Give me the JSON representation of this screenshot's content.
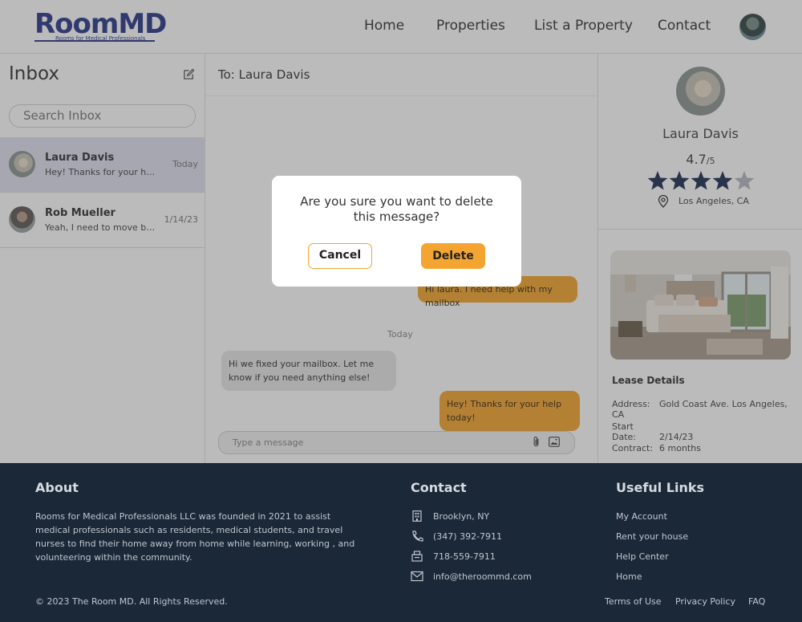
{
  "brand": {
    "logo_text": "RoomMD",
    "tagline": "Rooms for Medical Professionals",
    "accent_color": "#f4a531",
    "brand_color": "#2c3a8a"
  },
  "nav": {
    "home": "Home",
    "properties": "Properties",
    "list_property": "List a Property",
    "contact": "Contact"
  },
  "inbox": {
    "title": "Inbox",
    "search_placeholder": "Search Inbox",
    "conversations": [
      {
        "name": "Laura Davis",
        "preview": "Hey! Thanks for your help tod...",
        "date": "Today",
        "active": true
      },
      {
        "name": "Rob Mueller",
        "preview": "Yeah, I need to move by Fe...",
        "date": "1/14/23",
        "active": false
      }
    ]
  },
  "chat": {
    "to": "To: Laura Davis",
    "messages": [
      {
        "direction": "out",
        "text": "Hi laura. I need help with my mailbox"
      },
      {
        "direction": "in",
        "text": "Hi we fixed your mailbox. Let me know if you need anything else!"
      },
      {
        "direction": "out",
        "text": "Hey! Thanks for your help today!"
      }
    ],
    "day_separator": "Today",
    "input_placeholder": "Type a message"
  },
  "profile": {
    "name": "Laura Davis",
    "rating": "4.7",
    "rating_max": "/5",
    "stars_filled": 4,
    "stars_total": 5,
    "location": "Los Angeles, CA",
    "lease_title": "Lease Details",
    "lease": [
      {
        "label": "Address:",
        "value": "Gold Coast Ave. Los Angeles, CA"
      },
      {
        "label": "Start Date:",
        "value": "2/14/23"
      },
      {
        "label": "Contract:",
        "value": "6 months"
      }
    ]
  },
  "modal": {
    "message": "Are you sure you want to delete this message?",
    "cancel_label": "Cancel",
    "delete_label": "Delete"
  },
  "footer": {
    "about_title": "About",
    "about_text": "Rooms for Medical Professionals LLC was founded in 2021 to assist medical professionals such as residents, medical students, and travel nurses to find their home away from home while learning, working , and volunteering within the community.",
    "contact_title": "Contact",
    "contact_items": [
      {
        "icon": "building-icon",
        "text": "Brooklyn, NY"
      },
      {
        "icon": "phone-icon",
        "text": "(347) 392-7911"
      },
      {
        "icon": "fax-icon",
        "text": "718-559-7911"
      },
      {
        "icon": "mail-icon",
        "text": "info@theroommd.com"
      }
    ],
    "links_title": "Useful Links",
    "links": [
      "My Account",
      "Rent your house",
      "Help Center",
      "Home"
    ],
    "copyright": "© 2023 The Room MD. All Rights Reserved.",
    "bottom_links": [
      "Terms of Use",
      "Privacy Policy",
      "FAQ"
    ]
  }
}
